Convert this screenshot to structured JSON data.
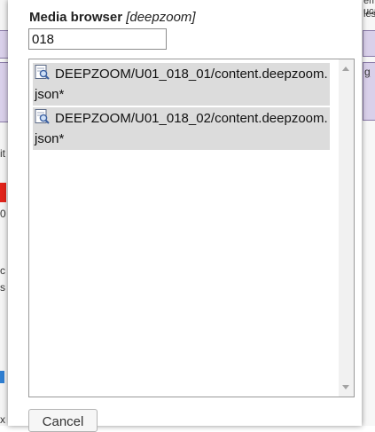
{
  "background": {
    "left_fragments": [
      "it",
      "0",
      "c",
      "s",
      "x"
    ],
    "right_fragments": [
      "ema uca",
      "les",
      "g"
    ]
  },
  "dialog": {
    "title": "Media browser",
    "context": "[deepzoom]",
    "search": {
      "value": "018",
      "placeholder": ""
    },
    "items": [
      {
        "label": "DEEPZOOM/U01_018_01/content.deepzoom.json*",
        "icon": "json-file-icon"
      },
      {
        "label": "DEEPZOOM/U01_018_02/content.deepzoom.json*",
        "icon": "json-file-icon"
      }
    ],
    "cancel_label": "Cancel"
  }
}
